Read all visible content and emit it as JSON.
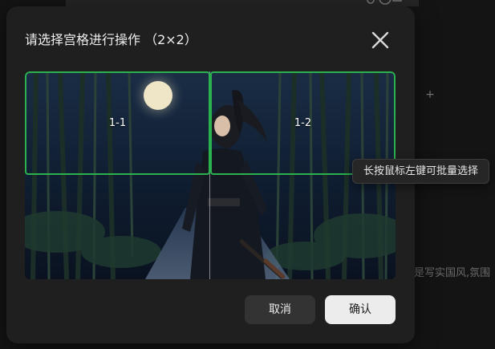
{
  "dialog": {
    "title": "请选择宫格进行操作 （2×2）",
    "close_icon": "close-icon",
    "grid": {
      "rows": 2,
      "cols": 2,
      "selected_cells": [
        {
          "label": "1-1"
        },
        {
          "label": "1-2"
        }
      ]
    },
    "tooltip": "长按鼠标左键可批量选择",
    "buttons": {
      "cancel": "取消",
      "confirm": "确认"
    },
    "selection_color": "#2bb14e"
  },
  "background": {
    "plus_icon": "plus-icon",
    "right_text": "是写实国风,氛围"
  }
}
